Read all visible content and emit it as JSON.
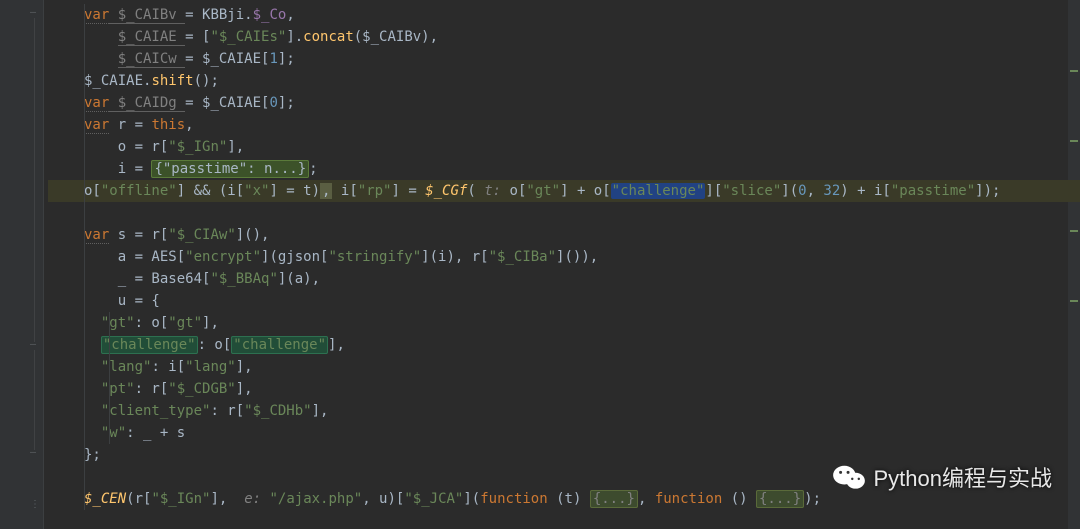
{
  "l1": {
    "var": "var",
    "gvar": " $_CAIBv ",
    "eq": "= ",
    "id1": "KBBji",
    "dot": ".",
    "p1": "$_Co",
    "c": ","
  },
  "l2": {
    "gid": "$_CAIAE ",
    "eq": "= [",
    "s": "\"$_CAIEs\"",
    "br": "].",
    "fn": "concat",
    "p": "($_CAIBv),"
  },
  "l3": {
    "gid": "$_CAICw ",
    "eq": "= ",
    "id": "$_CAIAE[",
    "n": "1",
    "e": "];"
  },
  "l4": {
    "id": "$_CAIAE.",
    "fn": "shift",
    "p": "();"
  },
  "l5": {
    "var": "var",
    "gid": " $_CAIDg ",
    "eq": "= $_CAIAE[",
    "n": "0",
    "e": "];"
  },
  "l6": {
    "var": "var",
    "txt": " r = ",
    "this": "this",
    "c": ","
  },
  "l7": {
    "txt": "o = r[",
    "s": "\"$_IGn\"",
    "e": "],"
  },
  "l8": {
    "txt": "i = ",
    "fold": "{\"passtime\": n...}",
    "e": ";"
  },
  "l9": {
    "a": "o[",
    "s1": "\"offline\"",
    "b": "] ",
    "amp": "&&",
    "c": " (i[",
    "s2": "\"x\"",
    "d": "] = t)",
    "box": ",",
    "e": " i[",
    "s3": "\"rp\"",
    "f": "] = ",
    "fn": "$_CGf",
    "g": "(",
    "par": " t: ",
    "h": "o[",
    "s4": "\"gt\"",
    "i": "] + o[",
    "hl": "\"challenge\"",
    "j": "][",
    "s5": "\"slice\"",
    "k": "](",
    "n1": "0",
    "cm": ", ",
    "n2": "32",
    "l": ") + i[",
    "s6": "\"passtime\"",
    "m": "]);"
  },
  "l10": {
    "blank": " "
  },
  "l11": {
    "var": "var",
    "txt": " s = r[",
    "s": "\"$_CIAw\"",
    "e": "](),"
  },
  "l12": {
    "txt": "a = AES[",
    "s1": "\"encrypt\"",
    "m": "](gjson[",
    "s2": "\"stringify\"",
    "n": "](i), r[",
    "s3": "\"$_CIBa\"",
    "e": "]()),"
  },
  "l13": {
    "txt": "_ = Base64[",
    "s": "\"$_BBAq\"",
    "e": "](a),"
  },
  "l14": {
    "txt": "u = {"
  },
  "l15": {
    "s1": "\"gt\"",
    "c": ": o[",
    "s2": "\"gt\"",
    "e": "],"
  },
  "l16": {
    "h1": "\"challenge\"",
    "c": ": o[",
    "h2": "\"challenge\"",
    "e": "],"
  },
  "l17": {
    "s1": "\"lang\"",
    "c": ": i[",
    "s2": "\"lang\"",
    "e": "],"
  },
  "l18": {
    "s1": "\"pt\"",
    "c": ": r[",
    "s2": "\"$_CDGB\"",
    "e": "],"
  },
  "l19": {
    "s1": "\"client_type\"",
    "c": ": r[",
    "s2": "\"$_CDHb\"",
    "e": "],"
  },
  "l20": {
    "s1": "\"w\"",
    "c": ": _ + s"
  },
  "l21": {
    "txt": "};"
  },
  "l22": {
    "blank": " "
  },
  "l23": {
    "fn": "$_CEN",
    "a": "(r[",
    "s1": "\"$_IGn\"",
    "b": "], ",
    "par": " e: ",
    "s2": "\"/ajax.php\"",
    "c": ", u)[",
    "s3": "\"$_JCA\"",
    "d": "](",
    "kw1": "function ",
    "e": "(t) ",
    "f1": "{...}",
    "cm": ", ",
    "kw2": "function ",
    "f": "() ",
    "f2": "{...}",
    "g": ");"
  },
  "watermark": "Python编程与实战"
}
